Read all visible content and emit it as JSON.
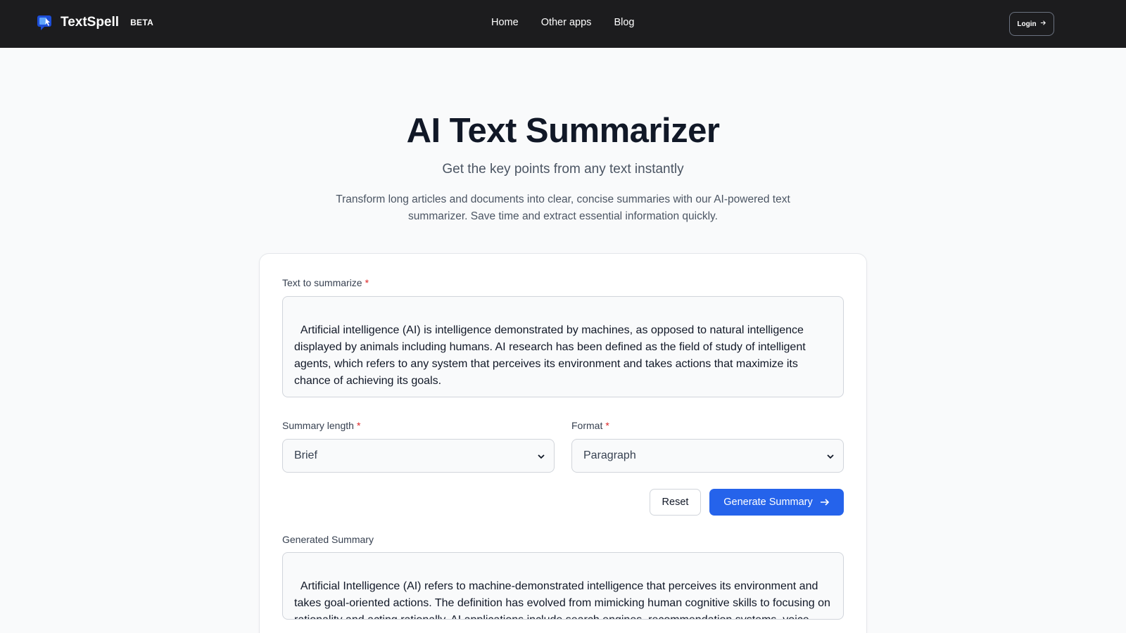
{
  "header": {
    "brand_name": "TextSpell",
    "brand_badge": "BETA",
    "nav": [
      {
        "label": "Home"
      },
      {
        "label": "Other apps"
      },
      {
        "label": "Blog"
      }
    ],
    "login_label": "Login",
    "login_icon": "arrow-right-icon"
  },
  "hero": {
    "title": "AI Text Summarizer",
    "subtitle": "Get the key points from any text instantly",
    "description": "Transform long articles and documents into clear, concise summaries with our AI-powered text summarizer. Save time and extract essential information quickly."
  },
  "form": {
    "input_label": "Text to summarize",
    "required_mark": "*",
    "input_value": "Artificial intelligence (AI) is intelligence demonstrated by machines, as opposed to natural intelligence displayed by animals including humans. AI research has been defined as the field of study of intelligent agents, which refers to any system that perceives its environment and takes actions that maximize its chance of achieving its goals.\n\nThe term \"artificial intelligence\" had previously been used to describe machines that mimic and display",
    "length_label": "Summary length",
    "length_value": "Brief",
    "format_label": "Format",
    "format_value": "Paragraph",
    "reset_label": "Reset",
    "generate_label": "Generate Summary",
    "output_label": "Generated Summary",
    "output_value": "Artificial Intelligence (AI) refers to machine-demonstrated intelligence that perceives its environment and takes goal-oriented actions. The definition has evolved from mimicking human cognitive skills to focusing on rationality and acting rationally. AI applications include search engines, recommendation systems, voice assistants, self-driving cars, generative tools, and strategic game systems. As AI"
  },
  "colors": {
    "topbar": "#1c1c1e",
    "accent": "#2563eb",
    "required": "#dc2626"
  }
}
